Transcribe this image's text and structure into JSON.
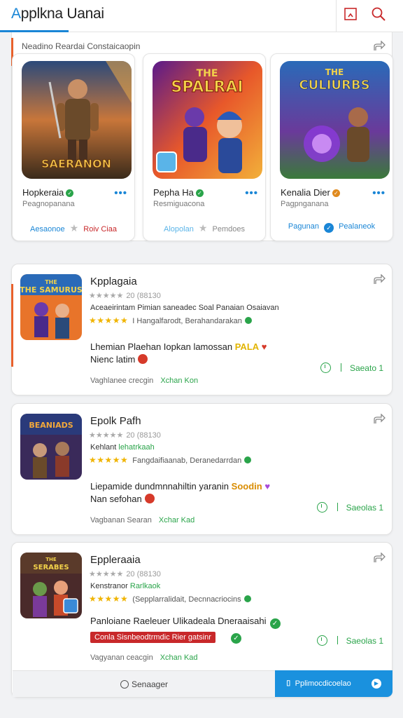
{
  "header": {
    "title_first": "A",
    "title_rest": "pplkna Uanai",
    "icons": [
      "bookmark-icon",
      "search-icon"
    ]
  },
  "featured": {
    "heading": "Neadino Reardai Constaicaopin",
    "games": [
      {
        "name": "Hopkeraia",
        "subtitle": "Peagnopanana",
        "art_text": "SAERANON",
        "verify_color": "#2aa44a",
        "action_left": "Aesaonoe",
        "action_right": "Roiv Ciaa",
        "action_left_color": "#1a86d6",
        "action_right_color": "#c8282a"
      },
      {
        "name": "Pepha Ha",
        "subtitle": "Resmiguacona",
        "art_text": "THE SPALRAI",
        "verify_color": "#2aa44a",
        "action_left": "Alopolan",
        "action_right": "Pemdoes",
        "action_left_color": "#5ab4e8",
        "action_right_color": "#888888"
      },
      {
        "name": "Kenalia Dier",
        "subtitle": "Pagpnganana",
        "art_text": "THE CULIURBS",
        "verify_color": "#e08a1e",
        "action_left": "Pagunan",
        "action_right": "Pealaneok",
        "action_left_color": "#1a86d6",
        "action_right_color": "#1a86d6"
      }
    ]
  },
  "list": [
    {
      "title": "Kpplagaia",
      "rating_count": "20 (88130",
      "line1": "Aceaeirintam Pimian saneadec Soal Panaian Osaiavan",
      "line1_green": "",
      "meta": "I Hangalfarodt, Berahandarakan",
      "desc": "Lhemian Plaehan Iopkan lamossan",
      "desc_tag": "PALA",
      "desc2": "Nienc latim",
      "footer_left": "Vaghlanee crecgin",
      "footer_right": "Xchan Kon",
      "status": "Saeato 1",
      "art_text": "THE SAMURUS"
    },
    {
      "title": "Epolk Pafh",
      "rating_count": "20 (88130",
      "line1": "Kehlant",
      "line1_green": "lehatrkaah",
      "meta": "Fangdaifiaanab, Deranedarrdan",
      "desc": "Liepamide dundmnnahiltin yaranin",
      "desc_tag": "Soodin",
      "desc2": "Nan sefohan",
      "footer_left": "Vagbanan Searan",
      "footer_right": "Xchar Kad",
      "status": "Saeolas 1",
      "art_text": "BEANIADS"
    },
    {
      "title": "Eppleraaia",
      "rating_count": "20 (88130",
      "line1": "Kenstranor",
      "line1_green": "Rarlkaok",
      "meta": "(Sepplarralidait, Decnnacriocins",
      "desc": "Panloiane Raeleuer Ulikadeala Dneraaisahi",
      "desc_tag": "",
      "desc2": "",
      "promo": "Conla Sisnbeodtrmdic Rier gatsinr",
      "footer_left": "Vagyanan ceacgin",
      "footer_right": "Xchan Kad",
      "status": "Saeolas 1",
      "art_text": "THE SERABES"
    }
  ],
  "bottom": {
    "left_label": "Senaager",
    "right_label": "Pplimocdicoelao"
  },
  "colors": {
    "accent": "#1a86d6",
    "orange_accent": "#e8612c",
    "green": "#2aa44a",
    "star": "#f0b400"
  }
}
